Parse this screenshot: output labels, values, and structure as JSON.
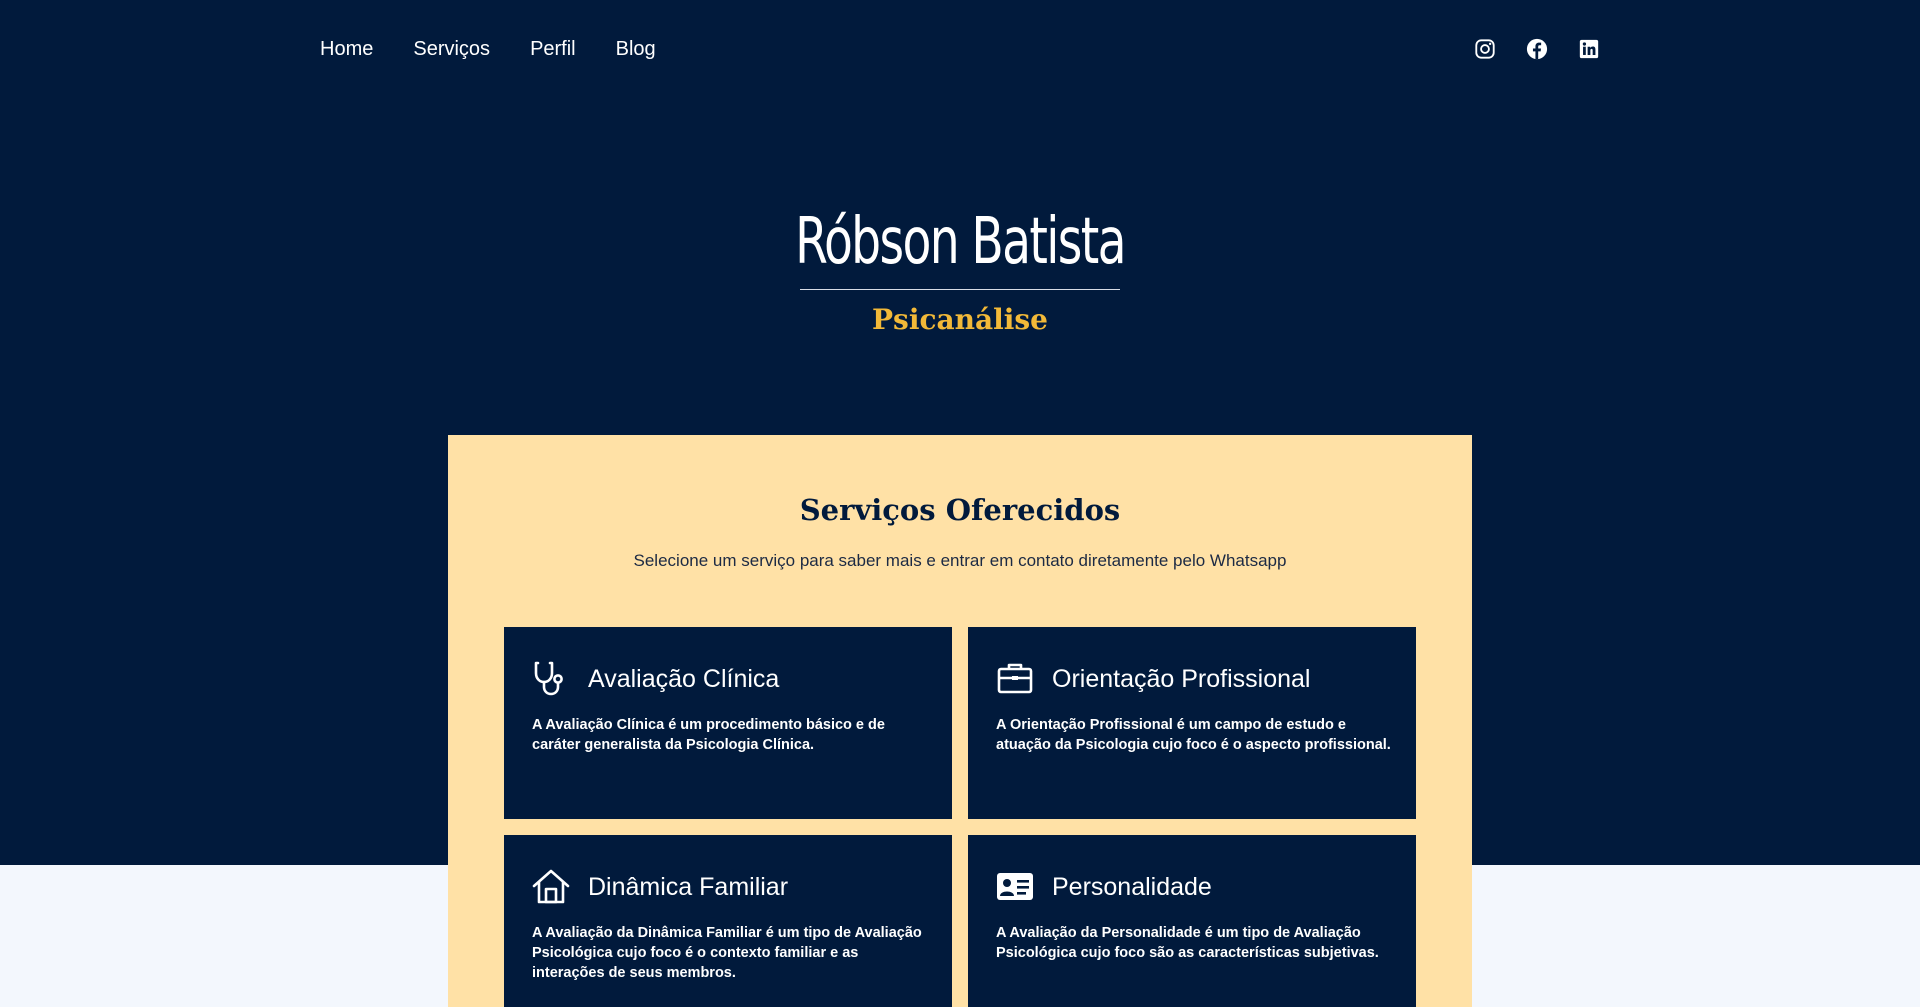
{
  "nav": {
    "items": [
      {
        "label": "Home"
      },
      {
        "label": "Serviços"
      },
      {
        "label": "Perfil"
      },
      {
        "label": "Blog"
      }
    ]
  },
  "social": {
    "icons": [
      "instagram-icon",
      "facebook-icon",
      "linkedin-icon"
    ]
  },
  "hero": {
    "name": "Róbson Batista",
    "subtitle": "Psicanálise"
  },
  "services": {
    "title": "Serviços Oferecidos",
    "subtitle": "Selecione um serviço para saber mais e entrar em contato diretamente pelo Whatsapp",
    "cards": [
      {
        "icon": "stethoscope-icon",
        "title": "Avaliação Clínica",
        "description": "A Avaliação Clínica é um procedimento básico e de caráter generalista da Psicologia Clínica."
      },
      {
        "icon": "briefcase-icon",
        "title": "Orientação Profissional",
        "description": "A Orientação Profissional é um campo de estudo e atuação da Psicologia cujo foco é o aspecto profissional."
      },
      {
        "icon": "house-icon",
        "title": "Dinâmica Familiar",
        "description": "A Avaliação da Dinâmica Familiar é um tipo de Avaliação Psicológica cujo foco é o contexto familiar e as interações de seus membros."
      },
      {
        "icon": "id-card-icon",
        "title": "Personalidade",
        "description": "A Avaliação da Personalidade é um tipo de Avaliação Psicológica cujo foco são as características subjetivas."
      }
    ]
  },
  "colors": {
    "navy": "#011a3c",
    "accent": "#f2b938",
    "panel": "#ffe1a6",
    "page": "#f3f7fd"
  }
}
